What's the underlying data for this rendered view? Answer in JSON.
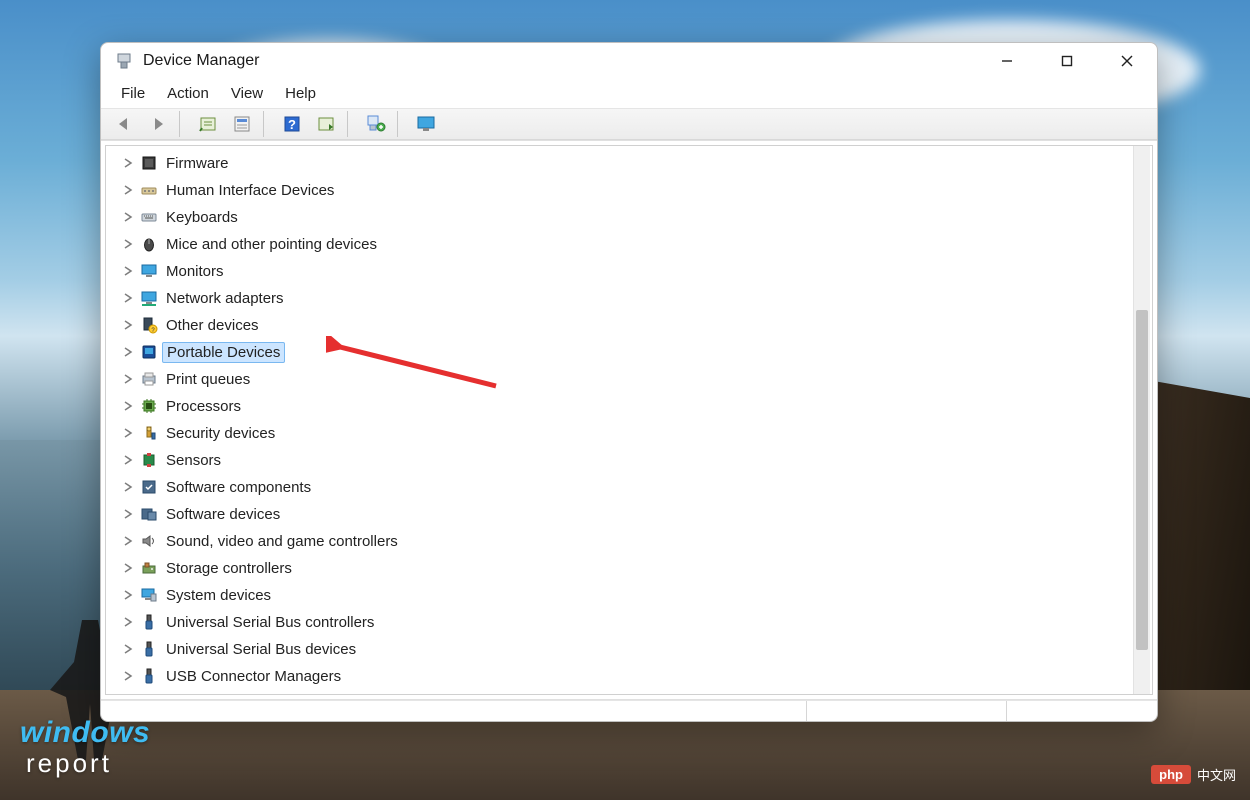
{
  "window": {
    "title": "Device Manager"
  },
  "menu": {
    "items": [
      "File",
      "Action",
      "View",
      "Help"
    ]
  },
  "toolbar": {
    "items": [
      {
        "name": "nav-back-icon"
      },
      {
        "name": "nav-forward-icon"
      },
      {
        "sep": true
      },
      {
        "name": "show-hidden-icon"
      },
      {
        "name": "properties-icon"
      },
      {
        "sep": true
      },
      {
        "name": "help-icon"
      },
      {
        "name": "action-icon"
      },
      {
        "sep": true
      },
      {
        "name": "scan-hardware-icon"
      },
      {
        "sep": true
      },
      {
        "name": "remote-display-icon"
      }
    ]
  },
  "tree": {
    "selected_index": 7,
    "nodes": [
      {
        "label": "Firmware",
        "icon": "firmware"
      },
      {
        "label": "Human Interface Devices",
        "icon": "hid"
      },
      {
        "label": "Keyboards",
        "icon": "keyboard"
      },
      {
        "label": "Mice and other pointing devices",
        "icon": "mouse"
      },
      {
        "label": "Monitors",
        "icon": "monitor"
      },
      {
        "label": "Network adapters",
        "icon": "network"
      },
      {
        "label": "Other devices",
        "icon": "other"
      },
      {
        "label": "Portable Devices",
        "icon": "portable"
      },
      {
        "label": "Print queues",
        "icon": "printer"
      },
      {
        "label": "Processors",
        "icon": "cpu"
      },
      {
        "label": "Security devices",
        "icon": "security"
      },
      {
        "label": "Sensors",
        "icon": "sensor"
      },
      {
        "label": "Software components",
        "icon": "swcomp"
      },
      {
        "label": "Software devices",
        "icon": "swdev"
      },
      {
        "label": "Sound, video and game controllers",
        "icon": "sound"
      },
      {
        "label": "Storage controllers",
        "icon": "storage"
      },
      {
        "label": "System devices",
        "icon": "system"
      },
      {
        "label": "Universal Serial Bus controllers",
        "icon": "usb"
      },
      {
        "label": "Universal Serial Bus devices",
        "icon": "usb"
      },
      {
        "label": "USB Connector Managers",
        "icon": "usb"
      }
    ]
  },
  "scrollbar": {
    "thumb_top_pct": 30,
    "thumb_height_pct": 62
  },
  "watermark_left": {
    "line1": "windows",
    "line2": "report"
  },
  "watermark_right": {
    "pill": "php",
    "text": "中文网"
  },
  "arrow": {
    "color": "#e52f2f"
  }
}
